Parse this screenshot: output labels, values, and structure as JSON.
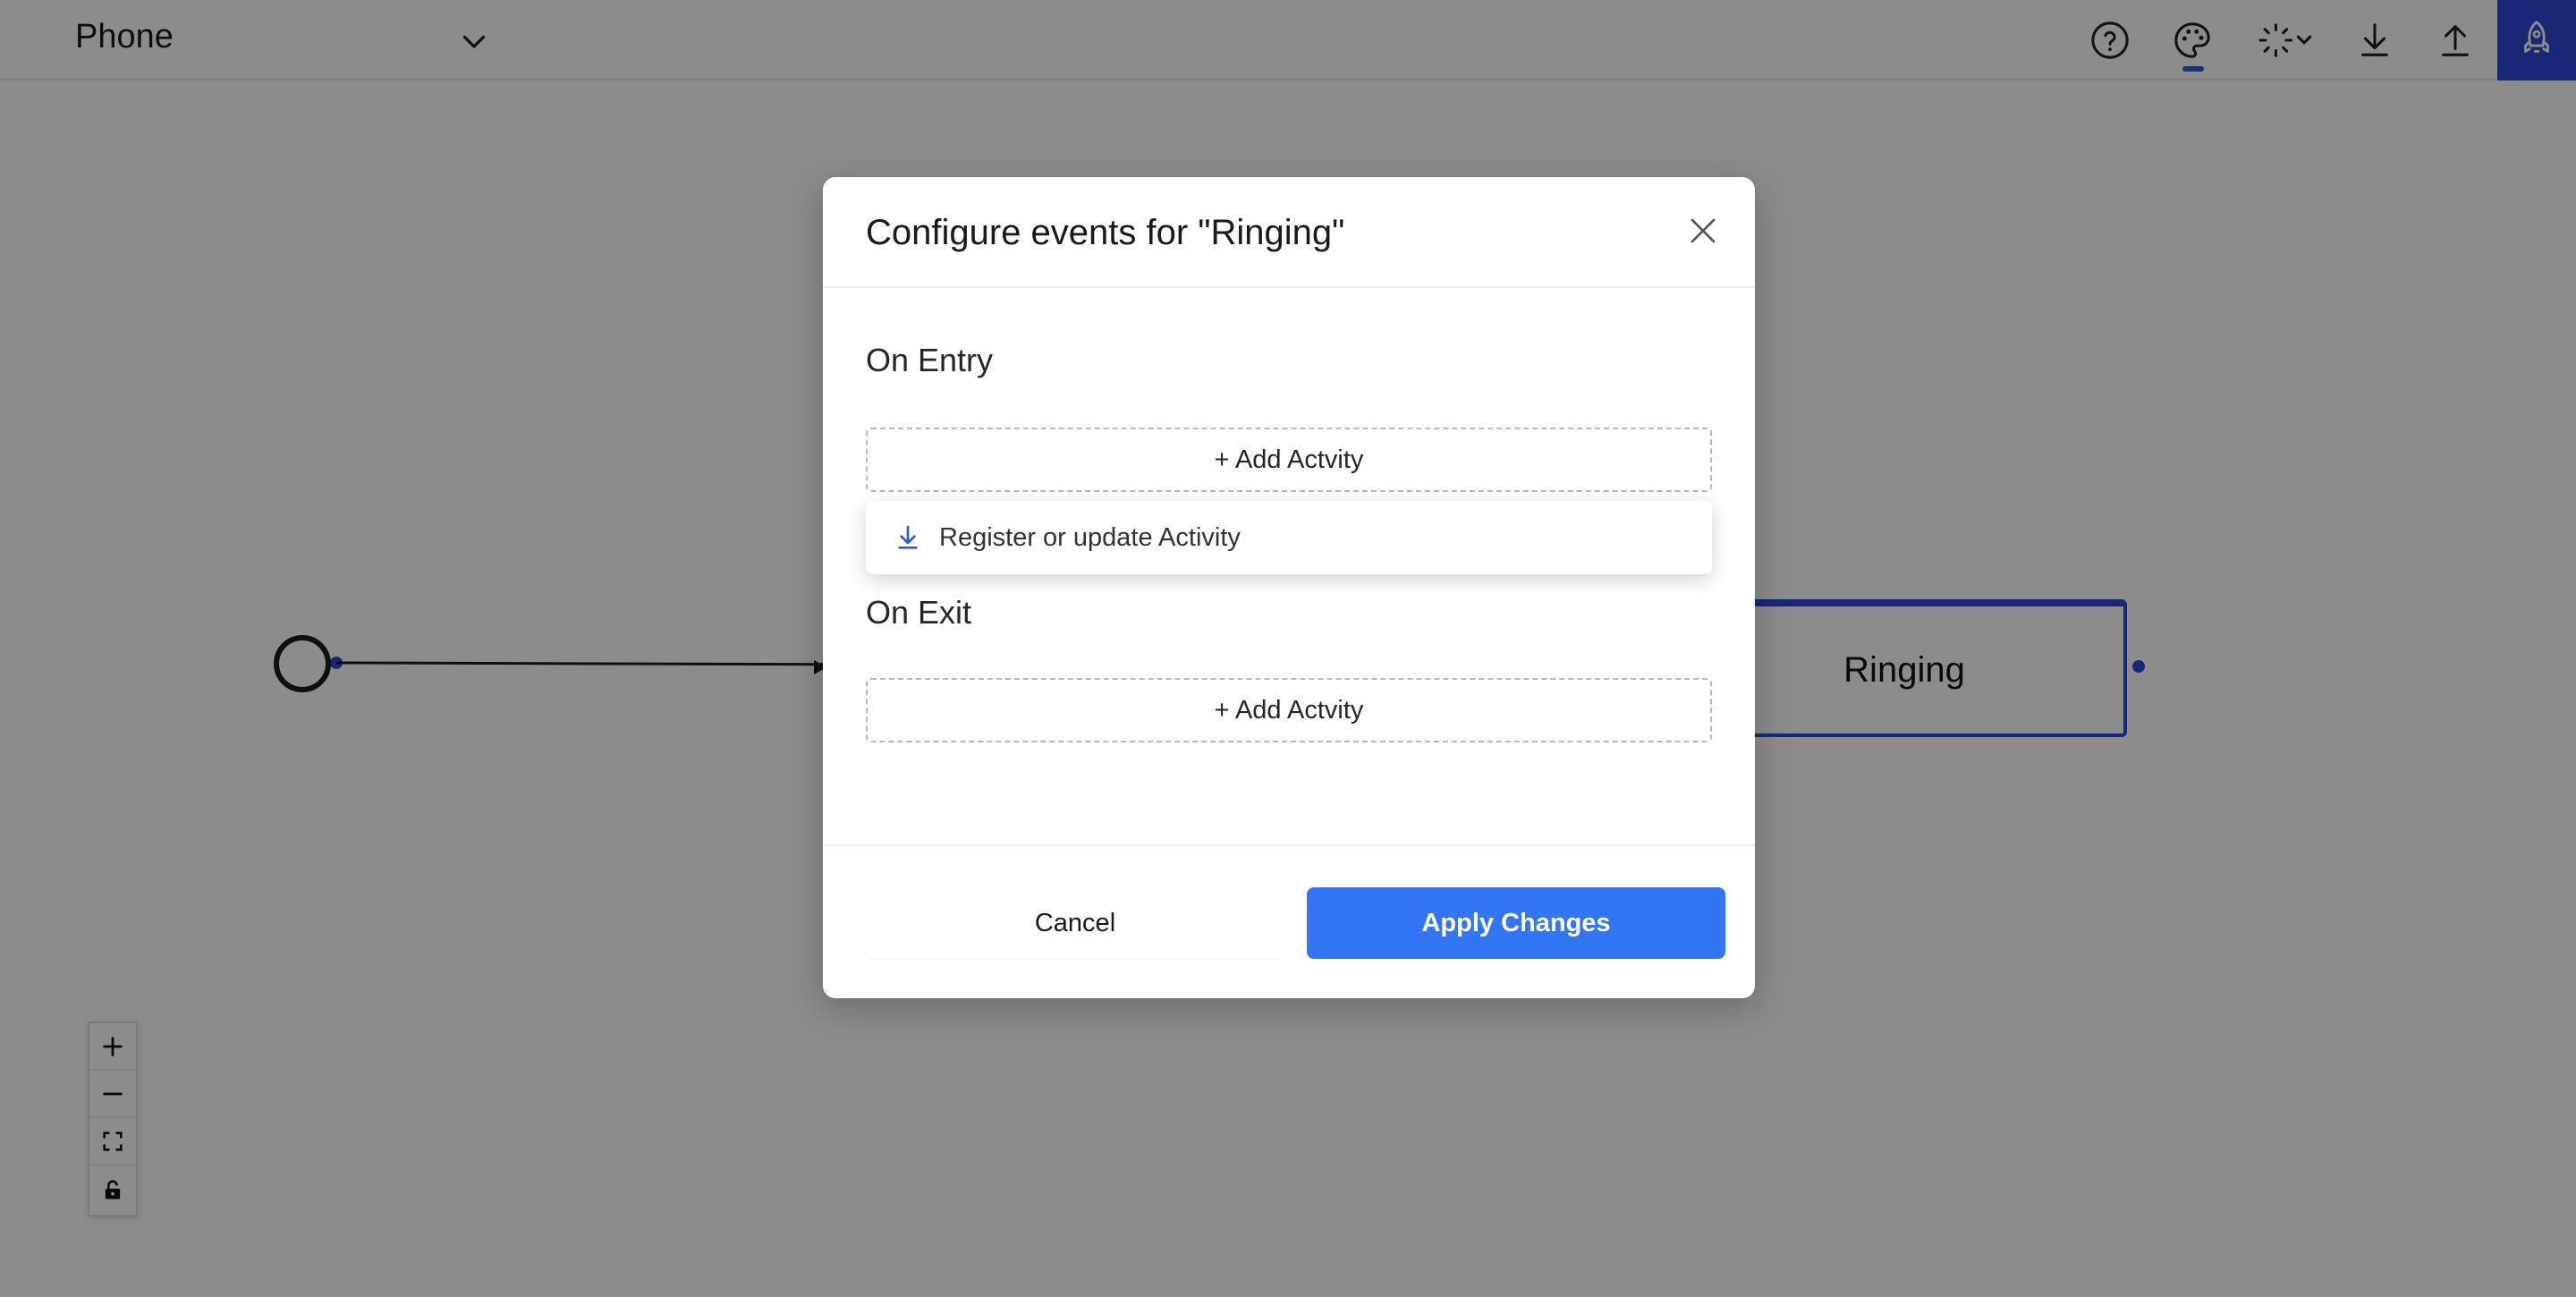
{
  "header": {
    "model_name": "Phone",
    "icons": [
      "help-circle-icon",
      "palette-icon",
      "loader-icon",
      "download-icon",
      "upload-icon",
      "rocket-icon"
    ]
  },
  "canvas": {
    "state_node_label": "Ringing",
    "zoom_controls": [
      "zoom-in-icon",
      "zoom-out-icon",
      "fit-view-icon",
      "lock-icon"
    ]
  },
  "modal": {
    "title": "Configure events for \"Ringing\"",
    "on_entry": {
      "title": "On Entry",
      "add_label": "+ Add Actvity"
    },
    "dropdown": {
      "items": [
        {
          "icon": "download-icon",
          "label": "Register or update Activity"
        }
      ]
    },
    "on_exit": {
      "title": "On Exit",
      "add_label": "+ Add Actvity"
    },
    "footer": {
      "cancel_label": "Cancel",
      "apply_label": "Apply Changes"
    }
  },
  "colors": {
    "accent": "#3275f5",
    "brand": "#2f49d6",
    "overlay": "rgba(0,0,0,0.45)"
  }
}
